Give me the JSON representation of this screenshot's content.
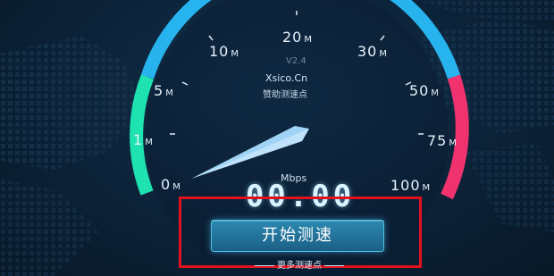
{
  "gauge": {
    "version": "V2.4",
    "brand": "Xsico.Cn",
    "sponsor": "赞助测速点",
    "unit_label": "Mbps",
    "speed_value": "00.00",
    "needle_icon": "gauge-needle-icon",
    "scale": [
      {
        "num": "0",
        "unit": "M"
      },
      {
        "num": "1",
        "unit": "M"
      },
      {
        "num": "5",
        "unit": "M"
      },
      {
        "num": "10",
        "unit": "M"
      },
      {
        "num": "20",
        "unit": "M"
      },
      {
        "num": "30",
        "unit": "M"
      },
      {
        "num": "50",
        "unit": "M"
      },
      {
        "num": "75",
        "unit": "M"
      },
      {
        "num": "100",
        "unit": "M"
      }
    ],
    "colors": {
      "arc_low": "#1ee3b0",
      "arc_mid": "#27b4ee",
      "arc_high": "#f0336f",
      "needle": "#a9dcff",
      "highlight": "#e0121f"
    }
  },
  "actions": {
    "start_label": "开始测速",
    "more_text": "更多测速点"
  }
}
